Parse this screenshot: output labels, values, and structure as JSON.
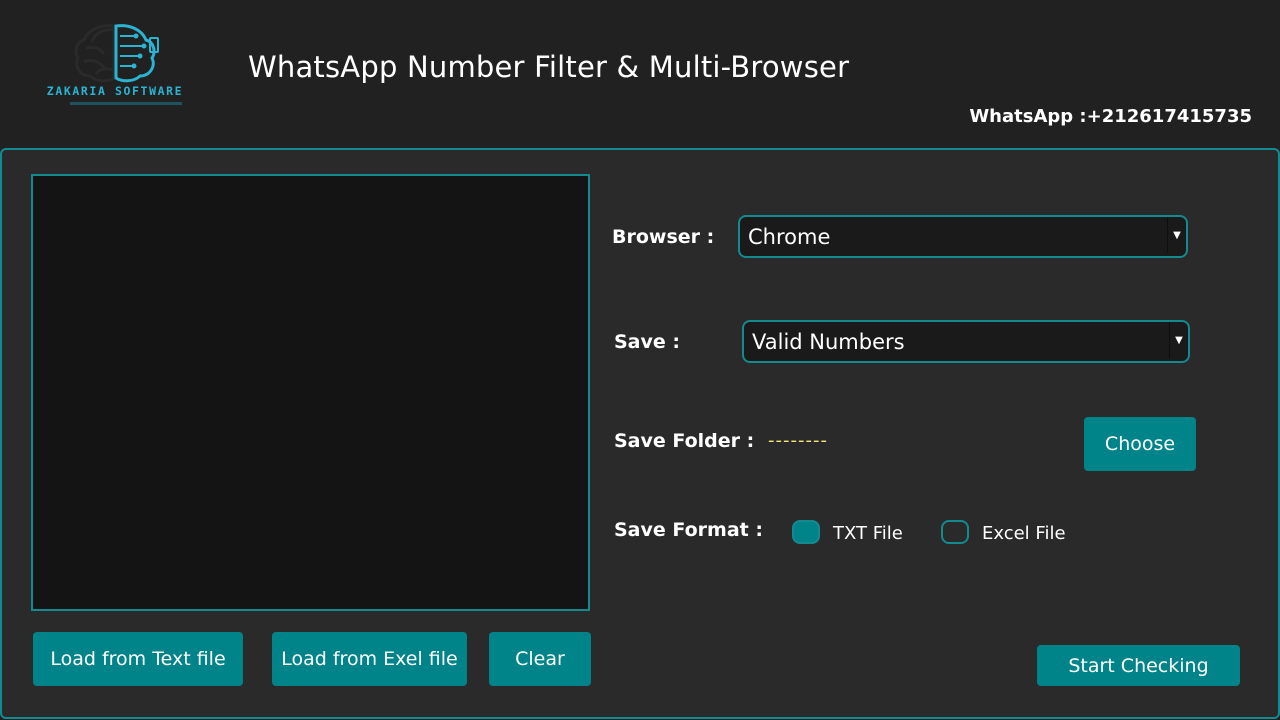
{
  "header": {
    "logo_text": "ZAKARIA SOFTWARE",
    "title": "WhatsApp Number Filter & Multi-Browser",
    "contact": "WhatsApp :+212617415735"
  },
  "numbers_area": {
    "value": ""
  },
  "buttons": {
    "load_text": "Load from Text file",
    "load_excel": "Load from Exel file",
    "clear": "Clear",
    "choose": "Choose",
    "start": "Start Checking"
  },
  "settings": {
    "browser_label": "Browser :",
    "browser_value": "Chrome",
    "save_label": "Save :",
    "save_value": "Valid Numbers",
    "folder_label": "Save Folder :",
    "folder_value": "--------",
    "format_label": "Save Format :",
    "format_options": [
      {
        "label": "TXT File",
        "selected": true
      },
      {
        "label": "Excel File",
        "selected": false
      }
    ]
  },
  "colors": {
    "accent": "#00848a",
    "border": "#138a8f",
    "logo": "#2ab4d2",
    "folder_value": "#f2e27a"
  }
}
